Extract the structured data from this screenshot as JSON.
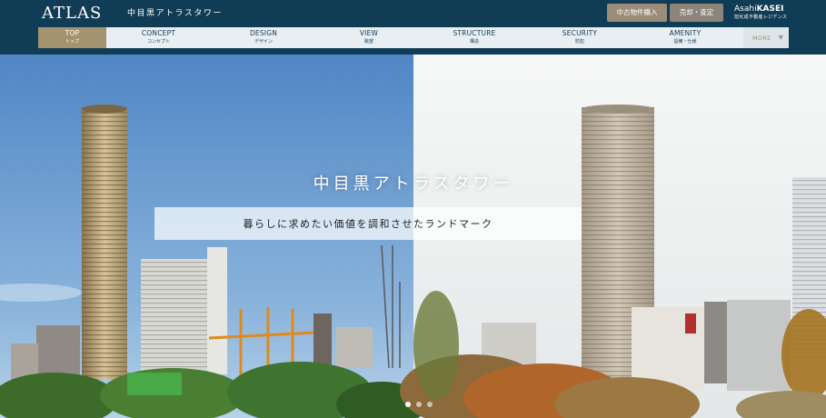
{
  "header": {
    "logo": "ATLAS",
    "site_name": "中目黒アトラスタワー",
    "buttons": {
      "used_purchase": "中古物件購入",
      "sell_appraise": "売却・査定"
    },
    "brand": {
      "name_light": "Asahi",
      "name_bold": "KASEI",
      "subtitle": "旭化成不動産レジデンス"
    }
  },
  "nav": {
    "items": [
      {
        "en": "TOP",
        "ja": "トップ"
      },
      {
        "en": "CONCEPT",
        "ja": "コンセプト"
      },
      {
        "en": "DESIGN",
        "ja": "デザイン"
      },
      {
        "en": "VIEW",
        "ja": "眺望"
      },
      {
        "en": "STRUCTURE",
        "ja": "構造"
      },
      {
        "en": "SECURITY",
        "ja": "防犯"
      },
      {
        "en": "AMENITY",
        "ja": "設備・仕様"
      }
    ],
    "active_index": 0,
    "more_label": "MORE"
  },
  "hero": {
    "title": "中目黒アトラスタワー",
    "tagline": "暮らしに求めたい価値を調和させたランドマーク",
    "slide_count": 3,
    "active_slide": 0
  },
  "colors": {
    "header_bg": "#113c55",
    "accent_gold": "#a3946f",
    "nav_bg": "#e8eef2"
  }
}
